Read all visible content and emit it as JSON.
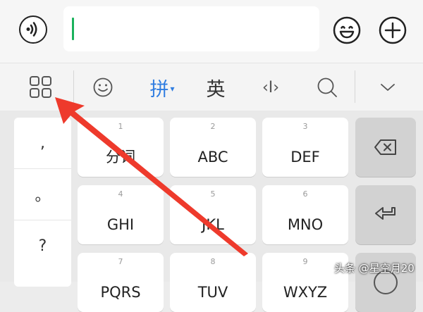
{
  "input_bar": {
    "voice_icon": "voice-input-icon",
    "emoji_icon": "emoji-icon",
    "plus_icon": "plus-icon",
    "accent_color": "#1ab25c"
  },
  "ime_toolbar": {
    "grid_icon": "grid-menu-icon",
    "emoji_icon": "smiley-icon",
    "pinyin_label": "拼",
    "english_label": "英",
    "cursor_label": "‹I›",
    "search_icon": "search-icon",
    "collapse_icon": "chevron-down-icon",
    "pinyin_color": "#2f7de1"
  },
  "keyboard": {
    "punctuation": [
      ",",
      "。",
      "?"
    ],
    "keys": [
      {
        "num": "1",
        "label": "分词"
      },
      {
        "num": "2",
        "label": "ABC"
      },
      {
        "num": "3",
        "label": "DEF"
      },
      {
        "num": "4",
        "label": "GHI"
      },
      {
        "num": "5",
        "label": "JKL"
      },
      {
        "num": "6",
        "label": "MNO"
      },
      {
        "num": "7",
        "label": "PQRS"
      },
      {
        "num": "8",
        "label": "TUV"
      },
      {
        "num": "9",
        "label": "WXYZ"
      }
    ],
    "backspace_icon": "backspace-icon",
    "enter_icon": "enter-icon"
  },
  "annotation": {
    "arrow_color": "#ee3a2c"
  },
  "watermark": "头条 @星空月20"
}
